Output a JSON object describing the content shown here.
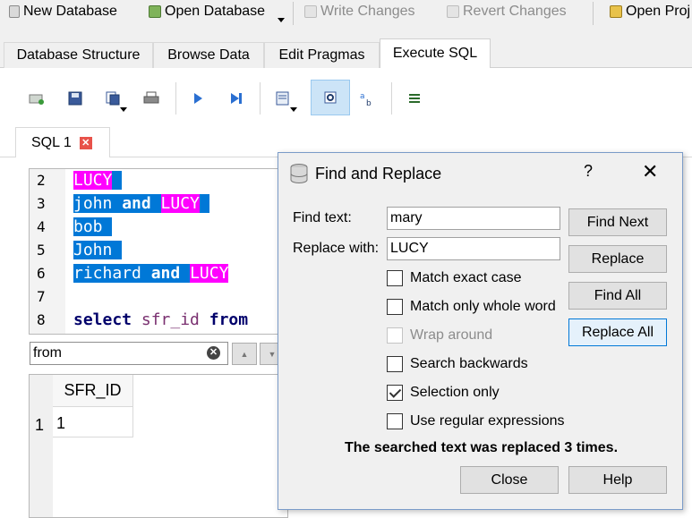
{
  "toolbar": {
    "new_database": "New Database",
    "open_database": "Open Database",
    "write_changes": "Write Changes",
    "revert_changes": "Revert Changes",
    "open_project": "Open Proj"
  },
  "tabs": [
    "Database Structure",
    "Browse Data",
    "Edit Pragmas",
    "Execute SQL"
  ],
  "sql_tab": {
    "label": "SQL 1"
  },
  "editor": {
    "line_numbers": [
      "2",
      "3",
      "4",
      "5",
      "6",
      "7",
      "8"
    ],
    "lines": {
      "l2": "LUCY",
      "l3a": "john ",
      "l3b": "and",
      "l3c": " ",
      "l3d": "LUCY",
      "l4": "bob",
      "l5": "John",
      "l6a": "richard ",
      "l6b": "and",
      "l6c": " ",
      "l6d": "LUCY",
      "l8a": "select",
      "l8b": " sfr_id ",
      "l8c": "from"
    }
  },
  "find_bar": {
    "value": "from",
    "up_arrow": "▲",
    "down_arrow": "▼"
  },
  "results": {
    "columns": [
      "SFR_ID"
    ],
    "row_numbers": [
      "1"
    ],
    "rows": [
      [
        "1"
      ]
    ]
  },
  "dialog": {
    "title": "Find and Replace",
    "help": "?",
    "close": "✕",
    "find_label": "Find text:",
    "find_value": "mary",
    "replace_label": "Replace with:",
    "replace_value": "LUCY",
    "options": {
      "match_case": "Match exact case",
      "whole_word": "Match only whole word",
      "wrap_around": "Wrap around",
      "search_backwards": "Search backwards",
      "selection_only": "Selection only",
      "regex": "Use regular expressions"
    },
    "buttons": {
      "find_next": "Find Next",
      "replace": "Replace",
      "find_all": "Find All",
      "replace_all": "Replace All",
      "close": "Close",
      "help": "Help"
    },
    "status": "The searched text was replaced 3 times."
  },
  "colors": {
    "selection": "#0078d7",
    "match_highlight": "#ff00ff",
    "accent": "#0078d7"
  }
}
